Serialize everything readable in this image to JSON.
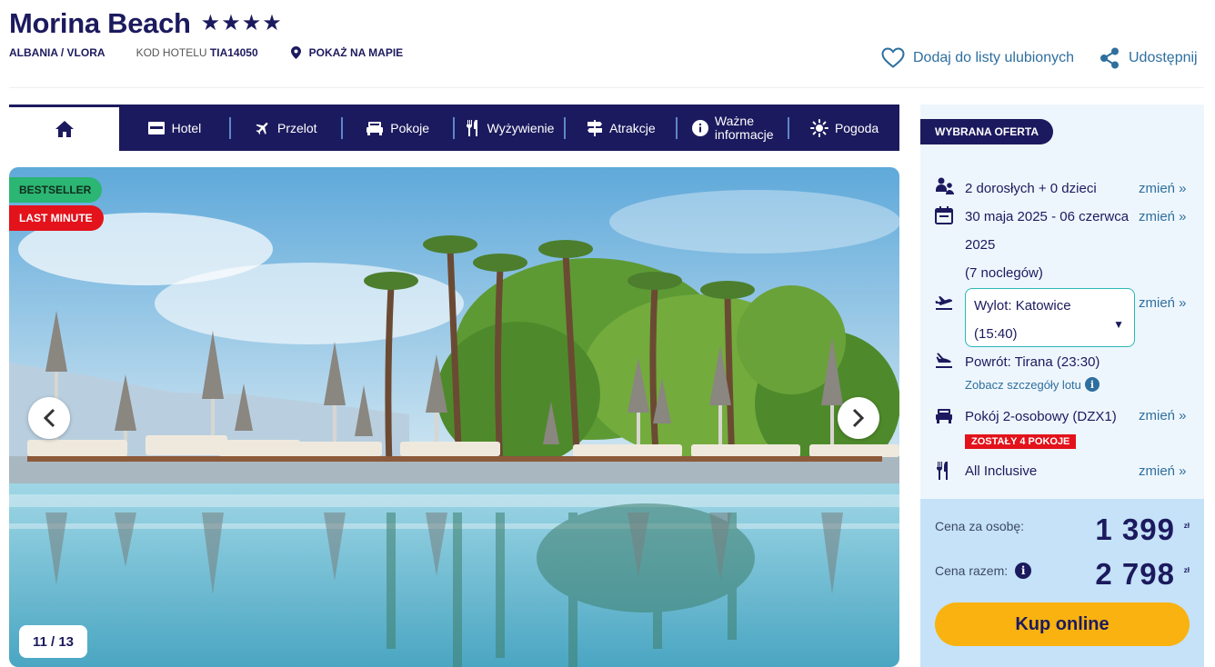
{
  "hotel": {
    "name": "Morina Beach",
    "stars": "★★★★",
    "location": "ALBANIA / VLORA",
    "code_label": "KOD HOTELU",
    "code": "TIA14050",
    "map_label": "POKAŻ NA MAPIE"
  },
  "actions": {
    "favorite": "Dodaj do listy ulubionych",
    "share": "Udostępnij"
  },
  "nav": {
    "items": [
      {
        "label": "Hotel",
        "icon": "hotel-icon"
      },
      {
        "label": "Przelot",
        "icon": "plane-icon"
      },
      {
        "label": "Pokoje",
        "icon": "bed-icon"
      },
      {
        "label": "Wyżywienie",
        "icon": "cutlery-icon"
      },
      {
        "label": "Atrakcje",
        "icon": "signpost-icon"
      },
      {
        "label": "Ważne informacje",
        "line1": "Ważne",
        "line2": "informacje",
        "icon": "info-icon"
      },
      {
        "label": "Pogoda",
        "icon": "sun-icon"
      }
    ]
  },
  "gallery": {
    "badges": [
      "BESTSELLER",
      "LAST MINUTE"
    ],
    "counter": "11 / 13"
  },
  "offer": {
    "tag": "WYBRANA OFERTA",
    "travelers": "2 dorosłych + 0 dzieci",
    "dates_line1": "30 maja 2025 - 06 czerwca",
    "dates_line2": "2025",
    "nights": "(7 noclegów)",
    "departure_line1": "Wylot: Katowice",
    "departure_line2": "(15:40)",
    "return": "Powrót: Tirana (23:30)",
    "flight_details": "Zobacz szczegóły lotu",
    "room": "Pokój 2-osobowy (DZX1)",
    "rooms_left": "ZOSTAŁY 4 POKOJE",
    "board": "All Inclusive",
    "change_label": "zmień »"
  },
  "price": {
    "per_person_label": "Cena za osobę:",
    "per_person": "1 399",
    "total_label": "Cena razem:",
    "total": "2 798",
    "currency": "zł",
    "buy_label": "Kup online"
  },
  "colors": {
    "navy": "#1c1a5e",
    "link": "#2e6f9e",
    "bestseller": "#2bb673",
    "last_minute": "#e3121b",
    "buy": "#f9b20f",
    "panel": "#eef6fd",
    "price_panel": "#c5e2f8"
  }
}
